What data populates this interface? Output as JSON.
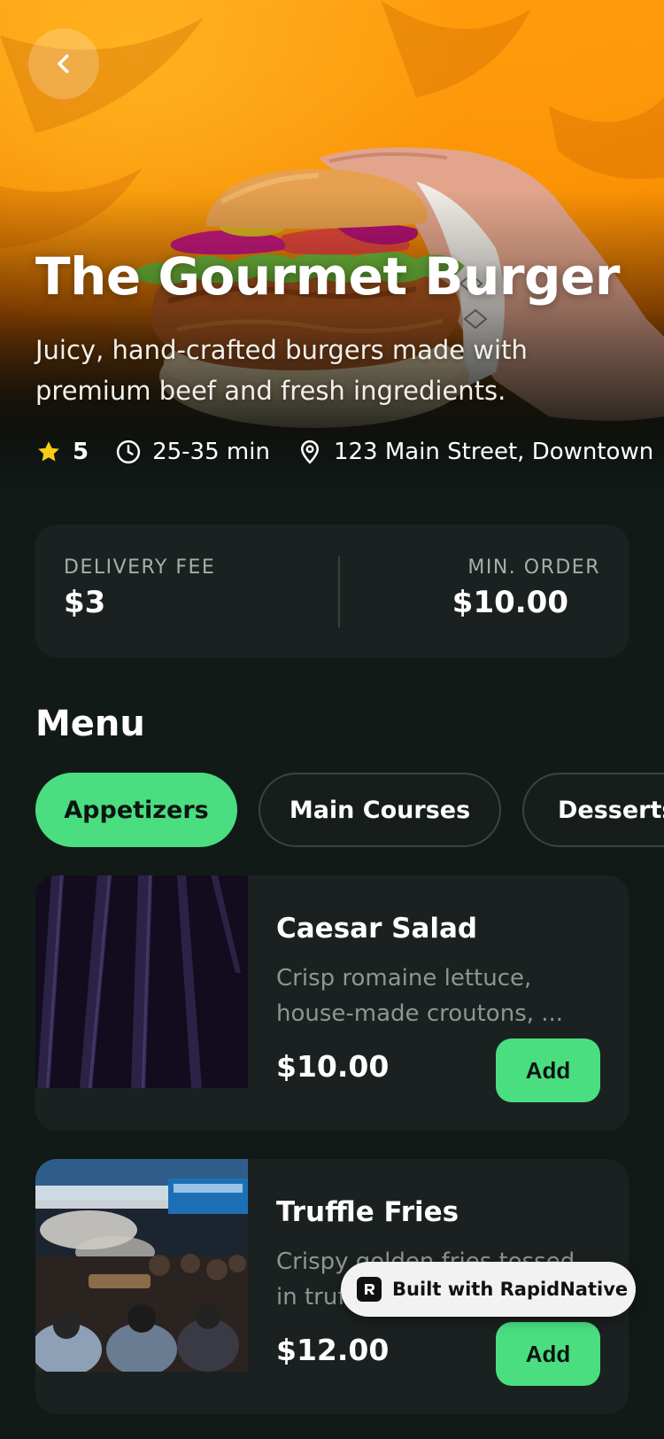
{
  "restaurant": {
    "name": "The Gourmet Burger",
    "description": "Juicy, hand-crafted burgers made with premium beef and fresh ingredients.",
    "rating": "5",
    "delivery_time": "25-35 min",
    "address": "123 Main Street, Downtown"
  },
  "info": {
    "delivery_fee_label": "DELIVERY FEE",
    "delivery_fee_value": "$3",
    "min_order_label": "MIN. ORDER",
    "min_order_value": "$10.00"
  },
  "menu": {
    "title": "Menu",
    "tabs": [
      {
        "label": "Appetizers",
        "active": true
      },
      {
        "label": "Main Courses",
        "active": false
      },
      {
        "label": "Desserts",
        "active": false
      }
    ],
    "items": [
      {
        "name": "Caesar Salad",
        "description": "Crisp romaine lettuce, house-made croutons, ...",
        "price": "$10.00",
        "add_label": "Add"
      },
      {
        "name": "Truffle Fries",
        "description": "Crispy golden fries tossed in truffle oil...",
        "price": "$12.00",
        "add_label": "Add"
      }
    ]
  },
  "badge": {
    "text": "Built with RapidNative"
  },
  "colors": {
    "accent": "#4ade80",
    "background": "#111a17",
    "card": "#1b2120",
    "star": "#facc15",
    "hero_orange": "#f58a00"
  },
  "icons": {
    "back": "chevron-left-icon",
    "rating": "star-icon",
    "time": "clock-icon",
    "location": "map-pin-icon",
    "badge": "rapidnative-logo-icon"
  }
}
